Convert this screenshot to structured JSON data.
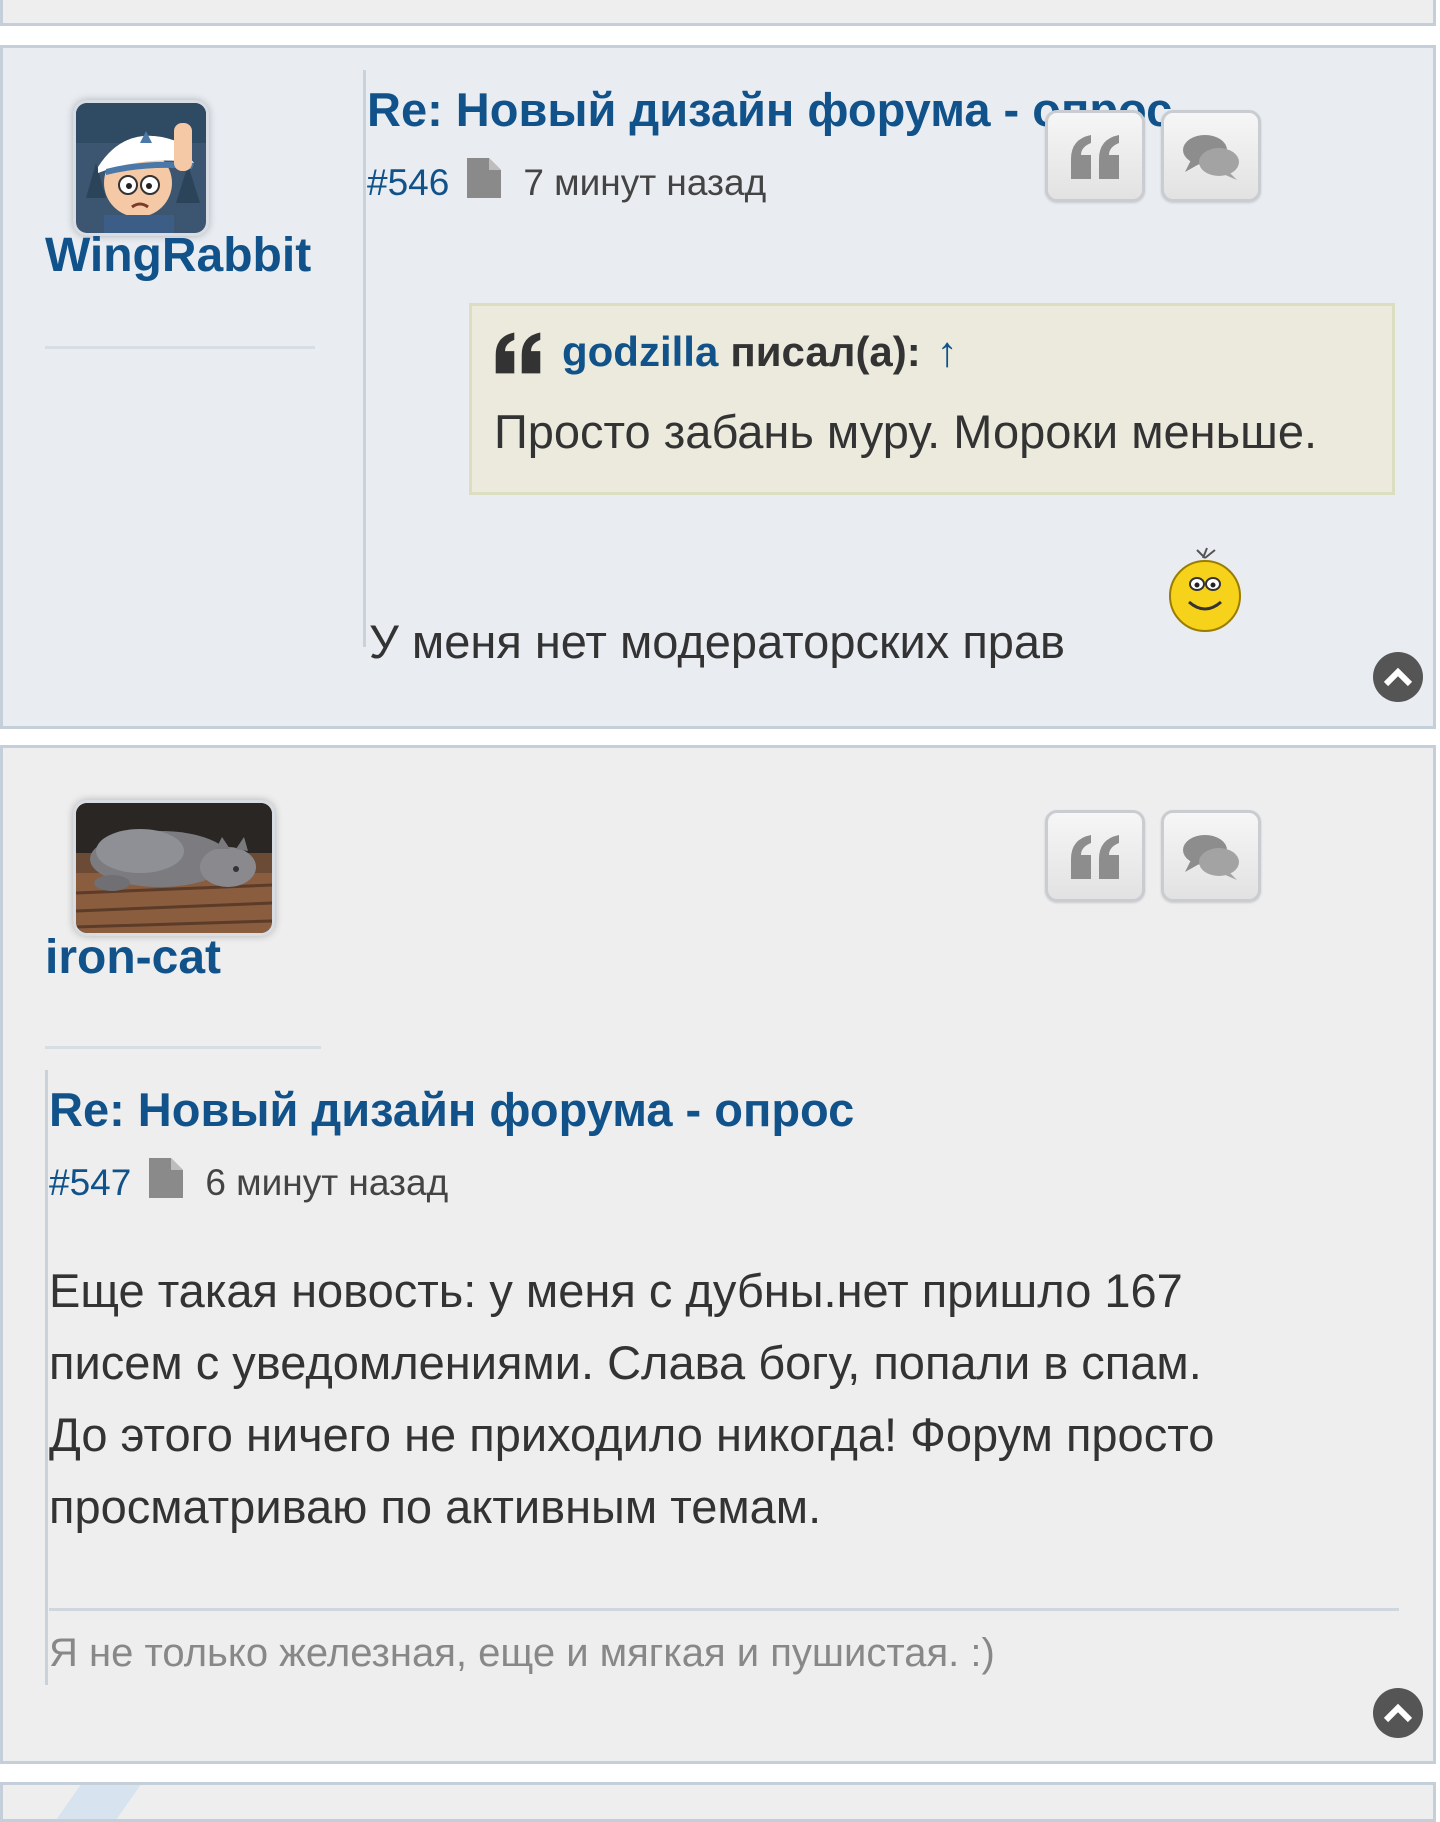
{
  "posts": [
    {
      "author": "WingRabbit",
      "title": "Re: Новый дизайн форума - опрос",
      "post_number": "#546",
      "time": "7 минут назад",
      "quote": {
        "author": "godzilla",
        "wrote_label": "писал(а):",
        "arrow": "↑",
        "text": "Просто забань муру. Мороки меньше."
      },
      "body": "У меня нет модераторских прав",
      "smiley": "smiley-icon"
    },
    {
      "author": "iron-cat",
      "title": "Re: Новый дизайн форума - опрос",
      "post_number": "#547",
      "time": "6 минут назад",
      "body_lines": [
        "Еще такая новость: у меня с дубны.нет пришло 167",
        "писем с уведомлениями. Слава богу, попали в спам.",
        "До этого ничего не приходило никогда! Форум просто",
        "просматриваю по активным темам."
      ],
      "signature": "Я не только железная, еще и мягкая и пушистая. :)"
    }
  ],
  "icons": {
    "quote_button": "quote-icon",
    "reply_button": "comments-icon",
    "back_to_top": "chevron-up-icon",
    "permalink": "file-icon"
  },
  "colors": {
    "link": "#105289",
    "post_bg_alt1": "#e9edf2",
    "post_bg_alt2": "#eeeeee",
    "quote_bg": "#ebeadd"
  }
}
